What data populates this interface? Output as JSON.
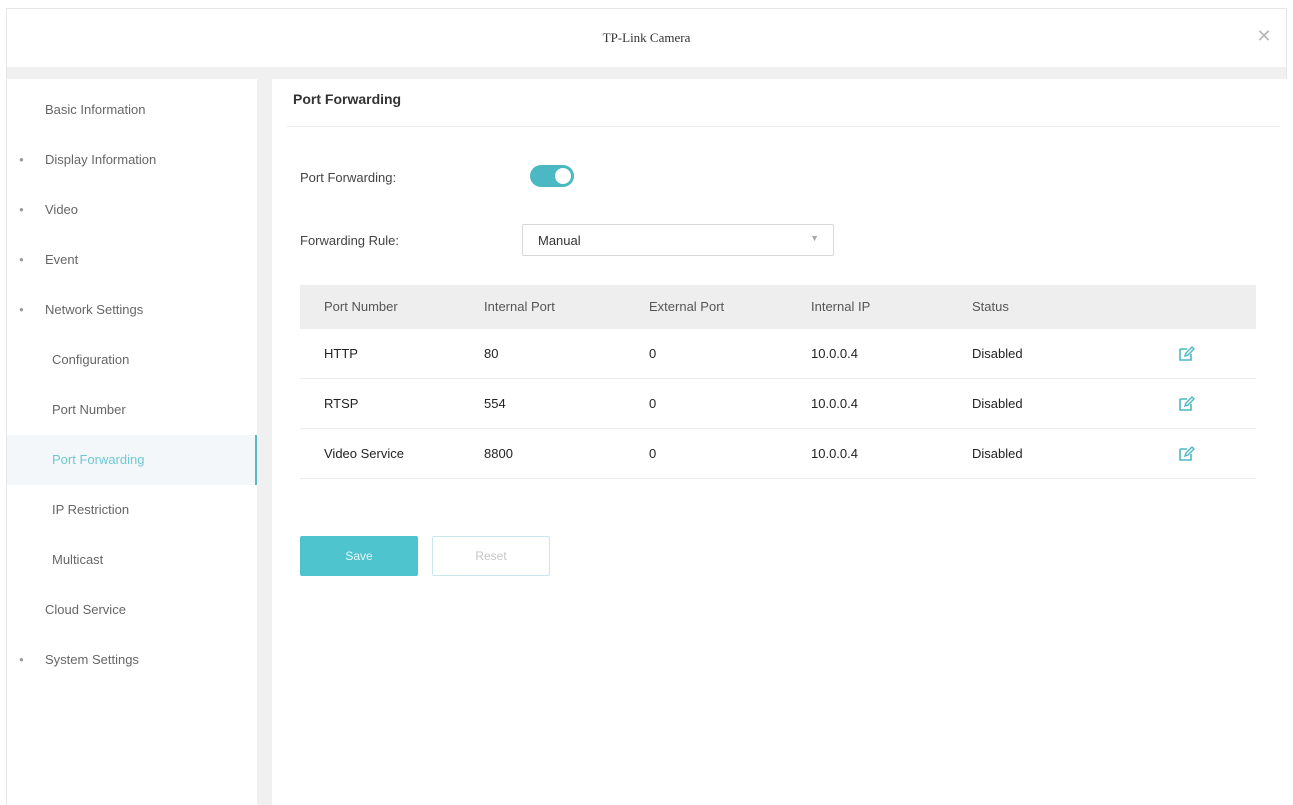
{
  "window": {
    "title": "TP-Link Camera",
    "close_glyph": "✕"
  },
  "sidebar": {
    "items": [
      {
        "label": "Basic Information",
        "has_dot": false
      },
      {
        "label": "Display Information",
        "has_dot": true
      },
      {
        "label": "Video",
        "has_dot": true
      },
      {
        "label": "Event",
        "has_dot": true
      },
      {
        "label": "Network Settings",
        "has_dot": true
      },
      {
        "label": "Configuration",
        "sub": true
      },
      {
        "label": "Port Number",
        "sub": true
      },
      {
        "label": "Port Forwarding",
        "sub": true,
        "active": true
      },
      {
        "label": "IP Restriction",
        "sub": true
      },
      {
        "label": "Multicast",
        "sub": true
      },
      {
        "label": "Cloud Service",
        "has_dot": false
      },
      {
        "label": "System Settings",
        "has_dot": true
      }
    ]
  },
  "main": {
    "section_title": "Port Forwarding",
    "port_forwarding_label": "Port Forwarding:",
    "port_forwarding_enabled": true,
    "forwarding_rule_label": "Forwarding Rule:",
    "forwarding_rule_value": "Manual",
    "table": {
      "headers": [
        "Port Number",
        "Internal Port",
        "External Port",
        "Internal IP",
        "Status"
      ],
      "rows": [
        [
          "HTTP",
          "80",
          "0",
          "10.0.0.4",
          "Disabled"
        ],
        [
          "RTSP",
          "554",
          "0",
          "10.0.0.4",
          "Disabled"
        ],
        [
          "Video Service",
          "8800",
          "0",
          "10.0.0.4",
          "Disabled"
        ]
      ]
    },
    "save_label": "Save",
    "reset_label": "Reset"
  },
  "colors": {
    "accent": "#4cb8c4",
    "active_text": "#6fc8d4",
    "header_bg": "#eeeeee"
  },
  "icons": {
    "close": "close-icon",
    "edit": "edit-icon",
    "dropdown": "chevron-down-icon"
  }
}
